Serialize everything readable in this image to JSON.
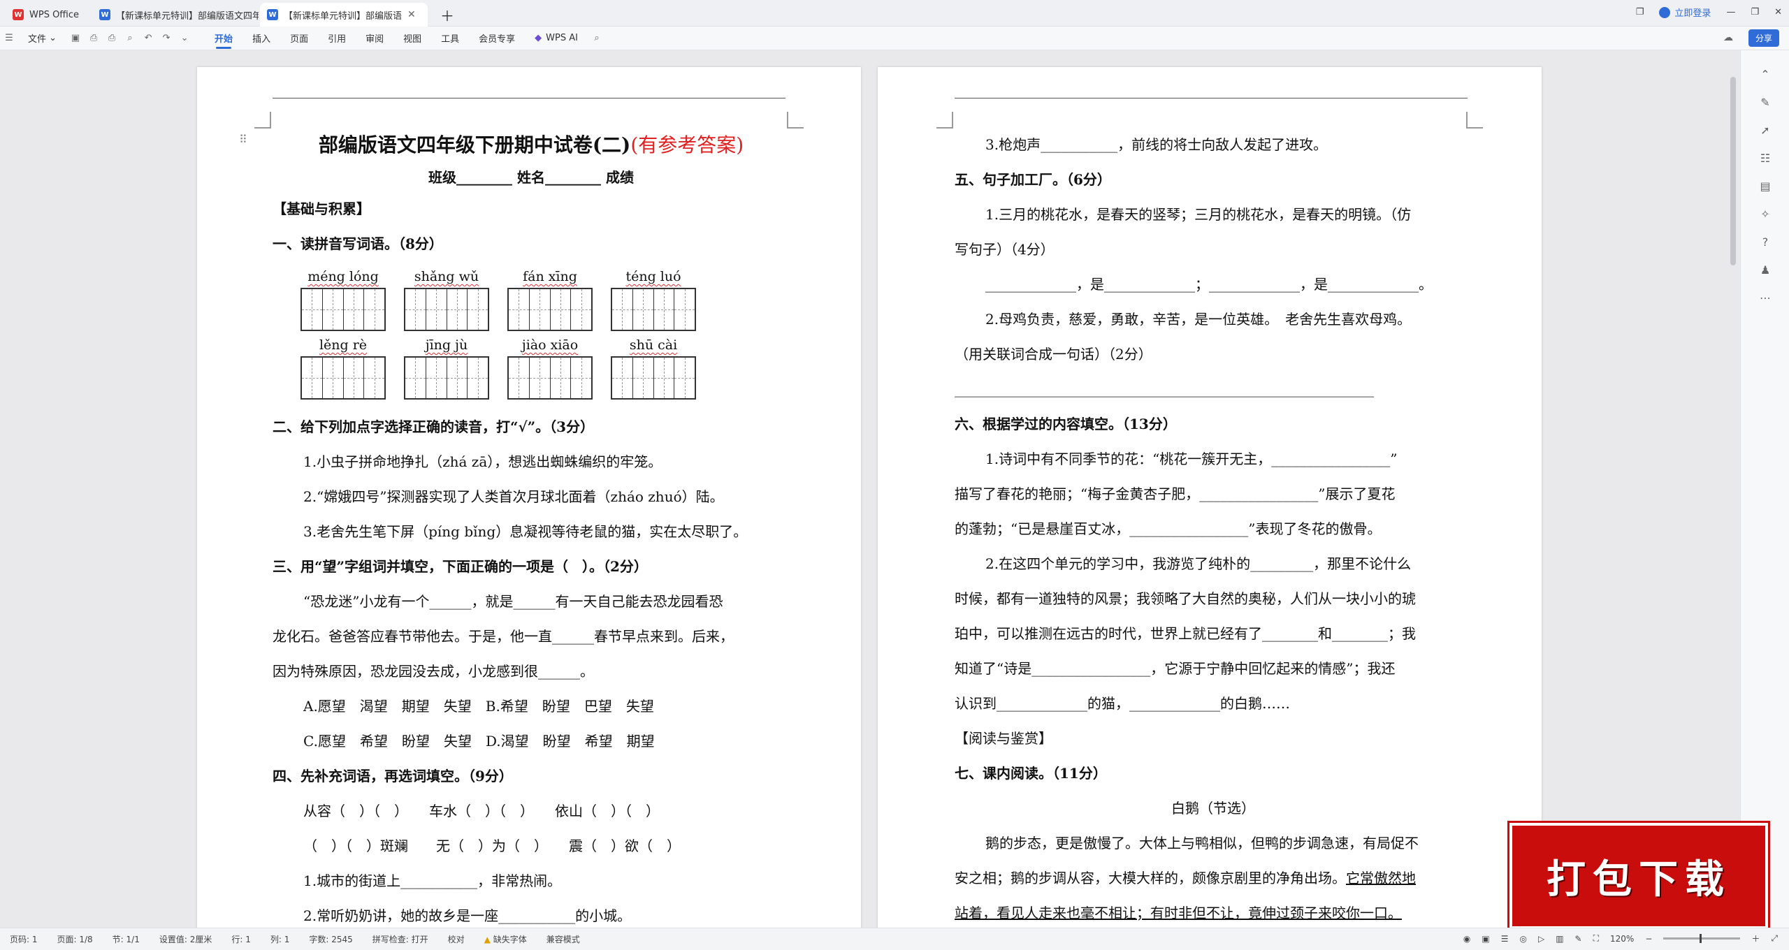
{
  "tabs": [
    {
      "label": "WPS Office",
      "icon": "wps-logo-icon"
    },
    {
      "label": "【新课标单元特训】部编版语文四年",
      "icon": "word-doc-icon"
    },
    {
      "label": "【新课标单元特训】部编版语",
      "icon": "word-doc-icon"
    }
  ],
  "titlebar": {
    "login": "立即登录"
  },
  "menu": {
    "file": "文件",
    "items": [
      "开始",
      "插入",
      "页面",
      "引用",
      "审阅",
      "视图",
      "工具",
      "会员专享"
    ],
    "active": "开始",
    "ai": "WPS AI",
    "share": "分享"
  },
  "page1": {
    "title": "部编版语文四年级下册期中试卷(二)",
    "title_red": "(有参考答案)",
    "info": "班级________   姓名________  成绩",
    "sec_basic": "【基础与积累】",
    "q1": "一、读拼音写词语。（8分）",
    "pinyin_row1": [
      "méng lóng",
      "shǎng wǔ",
      "fán xīng",
      "téng luó"
    ],
    "pinyin_row2": [
      "lěng rè",
      "jīng jù",
      "jiào xiāo",
      "shū cài"
    ],
    "q2": "二、给下列加点字选择正确的读音，打“√”。（3分）",
    "q2_1": "1.小虫子拼命地挣扎（zhá zā），想逃出蜘蛛编织的牢笼。",
    "q2_2": "2.“嫦娥四号”探测器实现了人类首次月球北面着（zháo zhuó）陆。",
    "q2_3": "3.老舍先生笔下屏（píng bǐng）息凝视等待老鼠的猫，实在太尽职了。",
    "q3": "三、用“望”字组词并填空，下面正确的一项是（　）。（2分）",
    "q3_p1": "“恐龙迷”小龙有一个______，就是______有一天自己能去恐龙园看恐",
    "q3_p2": "龙化石。爸爸答应春节带他去。于是，他一直______春节早点来到。后来，",
    "q3_p3": "因为特殊原因，恐龙园没去成，小龙感到很______。",
    "q3_a": "A.愿望　渴望　期望　失望　B.希望　盼望　巴望　失望",
    "q3_c": "C.愿望　希望　盼望　失望　D.渴望　盼望　希望　期望",
    "q4": "四、先补充词语，再选词填空。（9分）",
    "q4_w1": "从容（　）（　）　　车水（　）（　）　　依山（　）（　）",
    "q4_w2": "（　）（　）斑斓　　无（　）为（　）　　震（　）欲（　）",
    "q4_1": "1.城市的街道上___________，非常热闹。",
    "q4_2": "2.常听奶奶讲，她的故乡是一座___________的小城。"
  },
  "page2": {
    "l1": "3.枪炮声___________，前线的将士向敌人发起了进攻。",
    "q5": "五、句子加工厂。（6分）",
    "q5_1a": "1.三月的桃花水，是春天的竖琴；三月的桃花水，是春天的明镜。（仿",
    "q5_1b": "写句子）（4分）",
    "q5_1c": "_____________，是_____________；_____________，是_____________。",
    "q5_2a": "2.母鸡负责，慈爱，勇敢，辛苦，是一位英雄。　老舍先生喜欢母鸡。",
    "q5_2b": "（用关联词合成一句话）（2分）",
    "q5_2c": "____________________________________________________________",
    "q6": "六、根据学过的内容填空。（13分）",
    "q6_1a": "1.诗词中有不同季节的花：“桃花一簇开无主，_________________”",
    "q6_1b": "描写了春花的艳丽；“梅子金黄杏子肥，_________________”展示了夏花",
    "q6_1c": "的蓬勃；“已是悬崖百丈冰，_________________”表现了冬花的傲骨。",
    "q6_2a": "2.在这四个单元的学习中，我游览了纯朴的_________，那里不论什么",
    "q6_2b": "时候，都有一道独特的风景；我领略了大自然的奥秘，人们从一块小小的琥",
    "q6_2c": "珀中，可以推测在远古的时代，世界上就已经有了________和________；我",
    "q6_2d": "知道了“诗是_________________，它源于宁静中回忆起来的情感”；我还",
    "q6_2e": "认识到_____________的猫，_____________的白鹅……",
    "sec_read": "【阅读与鉴赏】",
    "q7": "七、课内阅读。（11分）",
    "passage_title": "白鹅（节选）",
    "p1": "鹅的步态，更是傲慢了。大体上与鸭相似，但鸭的步调急速，有局促不",
    "p2": "安之相；鹅的步调从容，大模大样的，颇像京剧里的净角出场。",
    "p2_u": "它常傲然地",
    "p3": "站着，看见人走来也毫不相让；有时非但不让，竟伸过颈子来咬你一口。"
  },
  "badge": "打包下载",
  "status": {
    "page": "页码: 1",
    "pages": "页面: 1/8",
    "section": "节: 1/1",
    "setting": "设置值: 2厘米",
    "row": "行: 1",
    "col": "列: 1",
    "words": "字数: 2545",
    "spell": "拼写检查: 打开",
    "proof": "校对",
    "font_missing": "缺失字体",
    "compat": "兼容模式",
    "zoom": "120%"
  }
}
